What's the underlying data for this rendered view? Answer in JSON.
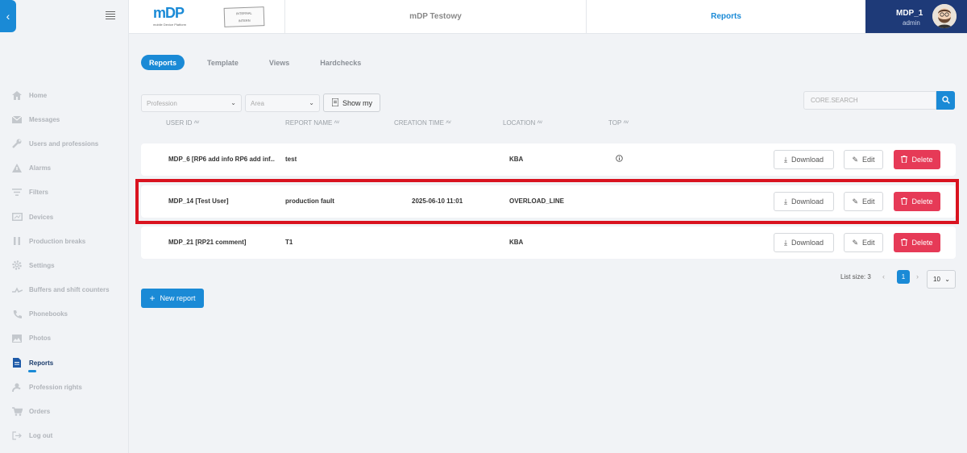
{
  "header": {
    "logo_text": "mDP",
    "logo_sub": "mobile Device Platform",
    "stamp_line1": "INTERNAL",
    "stamp_line2": "INTERN",
    "project": "mDP Testowy",
    "section": "Reports",
    "user_name": "MDP_1",
    "user_role": "admin"
  },
  "sidebar": {
    "items": [
      {
        "label": "Home",
        "icon": "home-icon"
      },
      {
        "label": "Messages",
        "icon": "envelope-icon"
      },
      {
        "label": "Users and professions",
        "icon": "wrench-icon"
      },
      {
        "label": "Alarms",
        "icon": "warning-icon"
      },
      {
        "label": "Filters",
        "icon": "filter-icon"
      },
      {
        "label": "Devices",
        "icon": "device-icon"
      },
      {
        "label": "Production breaks",
        "icon": "pause-icon"
      },
      {
        "label": "Settings",
        "icon": "gear-icon"
      },
      {
        "label": "Buffers and shift counters",
        "icon": "counter-icon"
      },
      {
        "label": "Phonebooks",
        "icon": "phone-icon"
      },
      {
        "label": "Photos",
        "icon": "image-icon"
      },
      {
        "label": "Reports",
        "icon": "document-icon"
      },
      {
        "label": "Profession rights",
        "icon": "user-key-icon"
      },
      {
        "label": "Orders",
        "icon": "cart-icon"
      },
      {
        "label": "Log out",
        "icon": "logout-icon"
      }
    ],
    "active_index": 11
  },
  "tabs": [
    {
      "label": "Reports",
      "active": true
    },
    {
      "label": "Template",
      "active": false
    },
    {
      "label": "Views",
      "active": false
    },
    {
      "label": "Hardchecks",
      "active": false
    }
  ],
  "filters": {
    "profession_placeholder": "Profession",
    "area_placeholder": "Area",
    "show_my_label": "Show my"
  },
  "search": {
    "placeholder": "CORE.SEARCH"
  },
  "table": {
    "columns": [
      "USER ID",
      "REPORT NAME",
      "CREATION TIME",
      "LOCATION",
      "TOP"
    ],
    "rows": [
      {
        "user_id": "MDP_6 [RP6 add info RP6 add inf...",
        "report_name": "test",
        "creation_time": "",
        "location": "KBA",
        "top": "info-circle-icon"
      },
      {
        "user_id": "MDP_14 [Test User]",
        "report_name": "production fault",
        "creation_time": "2025-06-10 11:01",
        "location": "OVERLOAD_LINE",
        "top": ""
      },
      {
        "user_id": "MDP_21 [RP21 comment]",
        "report_name": "T1",
        "creation_time": "",
        "location": "KBA",
        "top": ""
      }
    ],
    "download_label": "Download",
    "edit_label": "Edit",
    "delete_label": "Delete"
  },
  "pagination": {
    "list_size_label": "List size: 3",
    "current_page": "1",
    "page_size": "10"
  },
  "new_report_label": "New report",
  "colors": {
    "accent": "#1a8ad6",
    "danger": "#e63a57",
    "user_box": "#1e3a78",
    "highlight": "#d9131f"
  }
}
